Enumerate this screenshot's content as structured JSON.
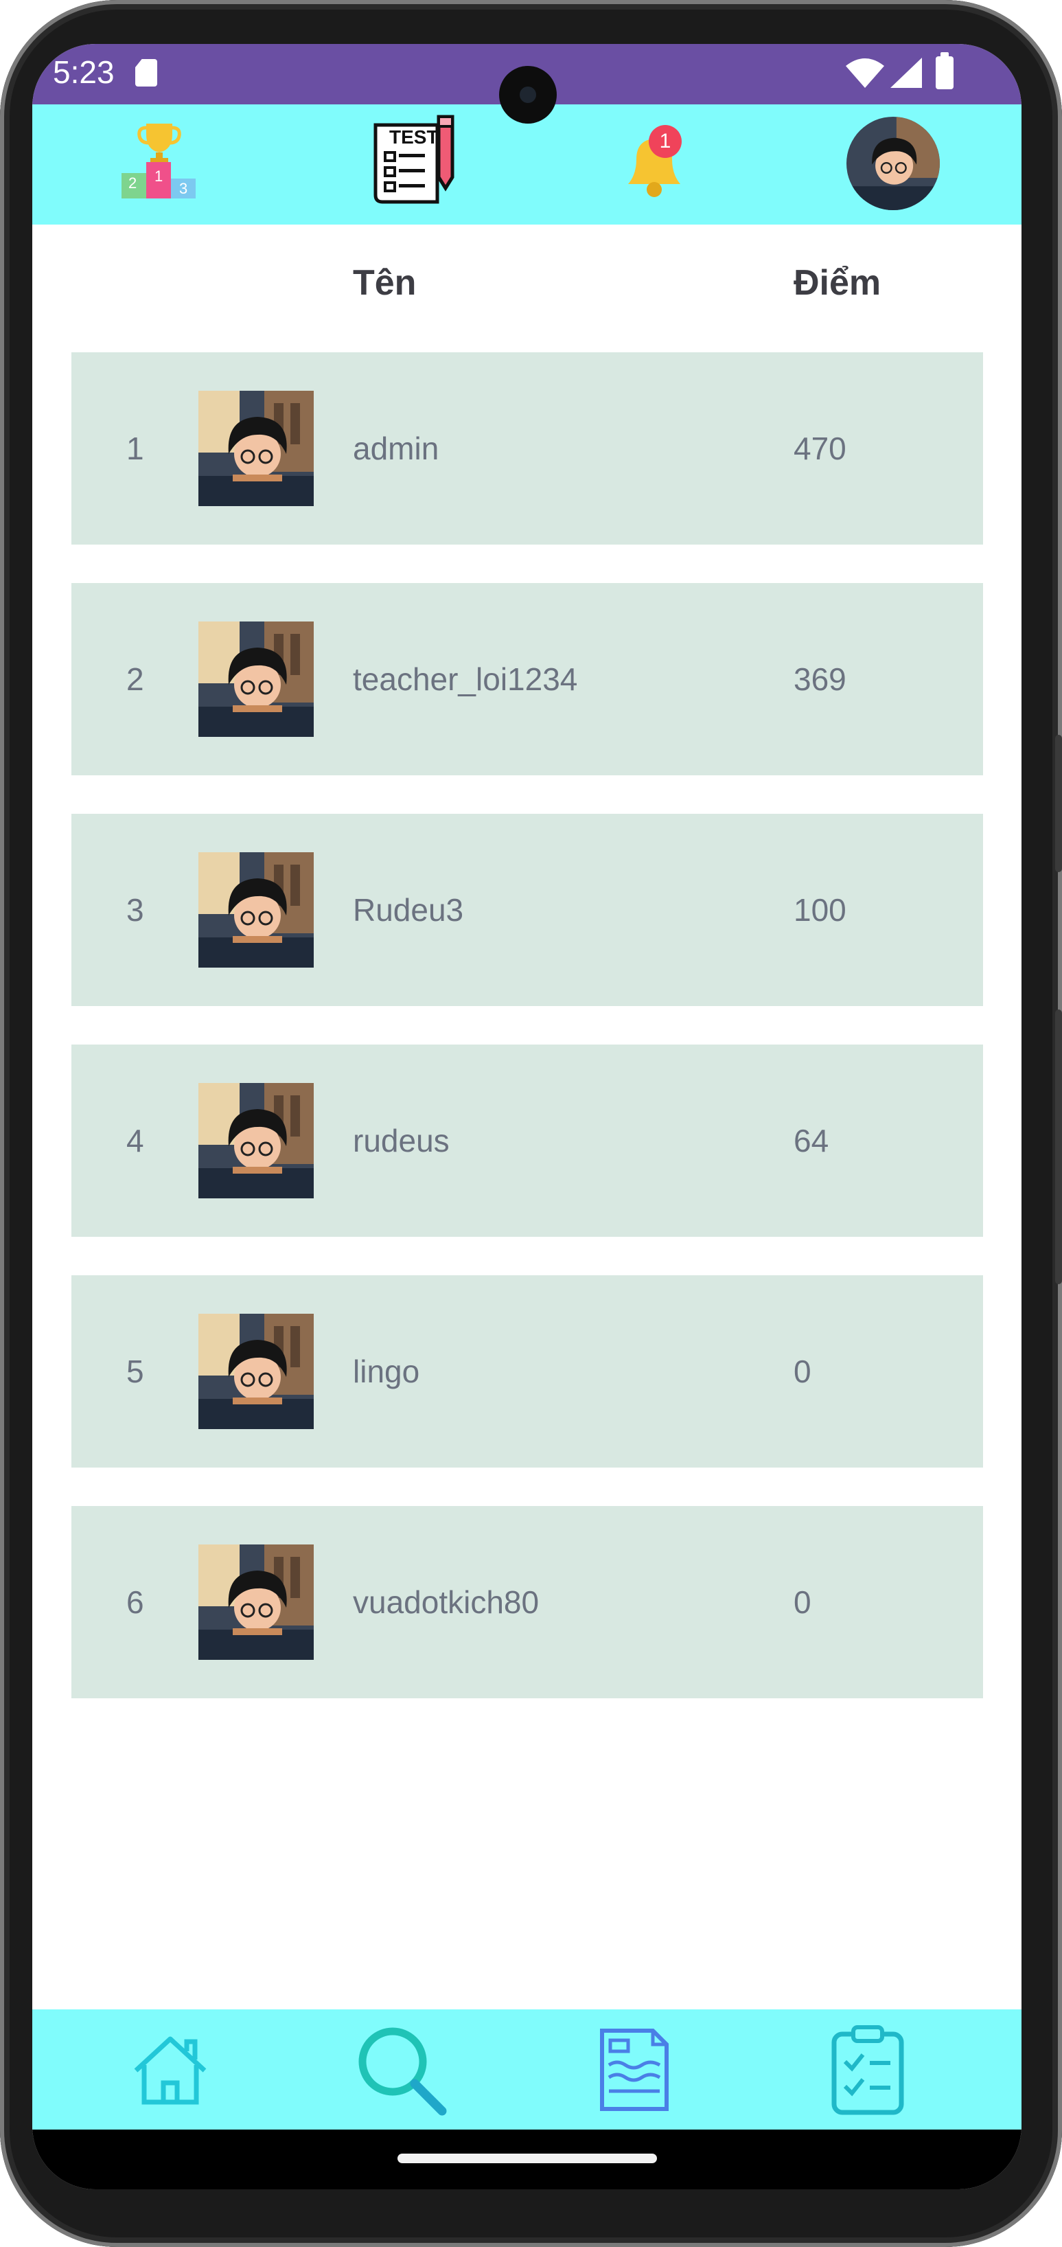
{
  "status_bar": {
    "time": "5:23",
    "icons": [
      "sd-card-icon",
      "wifi-icon",
      "signal-icon",
      "battery-icon"
    ]
  },
  "top_bar": {
    "items": [
      {
        "name": "leaderboard-podium-icon"
      },
      {
        "name": "test-list-icon",
        "text": "TEST"
      },
      {
        "name": "notification-bell-icon",
        "badge": "1"
      },
      {
        "name": "profile-avatar"
      }
    ],
    "podium_labels": [
      "2",
      "1",
      "3"
    ]
  },
  "leaderboard": {
    "headers": {
      "name": "Tên",
      "score": "Điểm"
    },
    "rows": [
      {
        "rank": "1",
        "name": "admin",
        "score": "470"
      },
      {
        "rank": "2",
        "name": "teacher_loi1234",
        "score": "369"
      },
      {
        "rank": "3",
        "name": "Rudeu3",
        "score": "100"
      },
      {
        "rank": "4",
        "name": "rudeus",
        "score": "64"
      },
      {
        "rank": "5",
        "name": "lingo",
        "score": "0"
      },
      {
        "rank": "6",
        "name": "vuadotkich80",
        "score": "0"
      }
    ]
  },
  "bottom_nav": {
    "items": [
      {
        "name": "home-icon"
      },
      {
        "name": "search-icon"
      },
      {
        "name": "document-icon"
      },
      {
        "name": "clipboard-checklist-icon"
      }
    ]
  },
  "colors": {
    "status_bar": "#6a4fa3",
    "app_bar": "#80fcfc",
    "row_background": "#d8e8e1",
    "badge": "#f0435a",
    "nav_icon": "#22c7d8"
  }
}
